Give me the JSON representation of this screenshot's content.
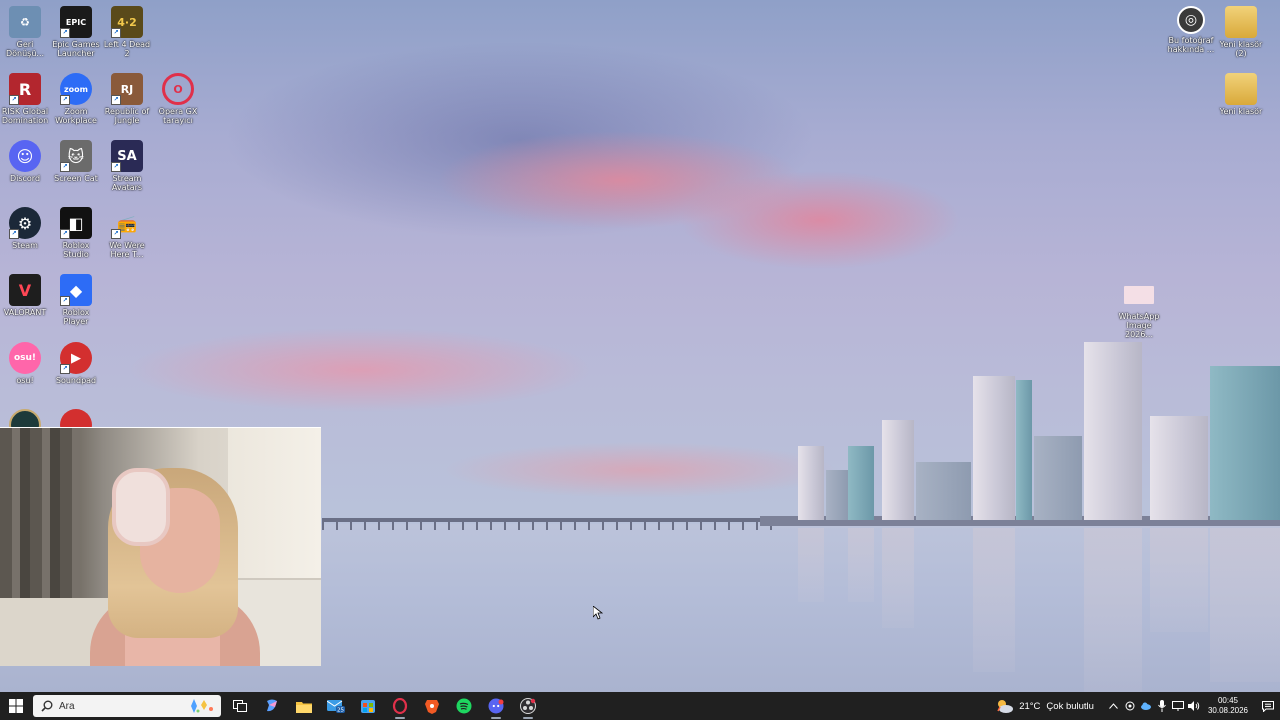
{
  "desktop": {
    "icons": [
      {
        "name": "recycle-bin",
        "label": "Geri Dönüşü...",
        "color": "#6d8fb3",
        "glyph": "♻"
      },
      {
        "name": "epic-games",
        "label": "Epic Games Launcher",
        "color": "#1a1a1a",
        "glyph": "EPIC"
      },
      {
        "name": "left-4-dead-2",
        "label": "Left 4 Dead 2",
        "color": "#5a4a1a",
        "glyph": "4·2"
      },
      {
        "name": "risk-global-domination",
        "label": "RISK Global Domination",
        "color": "#b3262e",
        "glyph": "R"
      },
      {
        "name": "zoom-workplace",
        "label": "Zoom Workplace",
        "color": "#2d6cf6",
        "glyph": "zoom"
      },
      {
        "name": "republic-of-jungle",
        "label": "Republic of Jungle",
        "color": "#8a5a3a",
        "glyph": "RJ"
      },
      {
        "name": "opera-gx",
        "label": "Opera GX tarayıcı",
        "color": "#ffffff",
        "glyph": "O"
      },
      {
        "name": "discord",
        "label": "Discord",
        "color": "#5865f2",
        "glyph": "☺"
      },
      {
        "name": "screen-cat",
        "label": "Screen Cat",
        "color": "#6b6b6b",
        "glyph": "🐱"
      },
      {
        "name": "stream-avatars",
        "label": "Stream Avatars",
        "color": "#2a2a55",
        "glyph": "SA"
      },
      {
        "name": "steam",
        "label": "Steam",
        "color": "#1b2838",
        "glyph": "⚙"
      },
      {
        "name": "roblox-studio",
        "label": "Roblox Studio",
        "color": "#111111",
        "glyph": "◧"
      },
      {
        "name": "we-were-here",
        "label": "We Were Here T...",
        "color": "#b83a2a",
        "glyph": "📻"
      },
      {
        "name": "valorant",
        "label": "VALORANT",
        "color": "#1e1e1e",
        "glyph": "V"
      },
      {
        "name": "roblox-player",
        "label": "Roblox Player",
        "color": "#2d6cf6",
        "glyph": "◆"
      },
      {
        "name": "osu",
        "label": "osu!",
        "color": "#ff66aa",
        "glyph": "osu!"
      },
      {
        "name": "soundpad",
        "label": "Soundpad",
        "color": "#d32f2f",
        "glyph": "▶"
      },
      {
        "name": "photo-info",
        "label": "Bu fotoğraf hakkında ...",
        "color": "#3a3a3a",
        "glyph": "◎"
      },
      {
        "name": "new-folder-2",
        "label": "Yeni klasör (2)",
        "color": "#e9c46a",
        "glyph": "▬"
      },
      {
        "name": "new-folder",
        "label": "Yeni klasör",
        "color": "#e9c46a",
        "glyph": "▬"
      },
      {
        "name": "whatsapp-image",
        "label": "WhatsApp Image 2026...",
        "color": "#f4dfe6",
        "glyph": ""
      }
    ]
  },
  "taskbar": {
    "search_placeholder": "Ara",
    "apps": [
      {
        "name": "task-view",
        "glyph": "▣",
        "color": "#ffffff",
        "running": false
      },
      {
        "name": "copilot",
        "glyph": "✦",
        "color": "#7db4ff",
        "running": false
      },
      {
        "name": "file-explorer",
        "glyph": "▬",
        "color": "#f5c342",
        "running": false
      },
      {
        "name": "mail-badge",
        "glyph": "✉",
        "color": "#3b9ce6",
        "running": false
      },
      {
        "name": "store",
        "glyph": "▦",
        "color": "#4aa3f0",
        "running": false
      },
      {
        "name": "opera-gx-taskbar",
        "glyph": "O",
        "color": "#e0304a",
        "running": true
      },
      {
        "name": "brave",
        "glyph": "◆",
        "color": "#f25a24",
        "running": false
      },
      {
        "name": "spotify",
        "glyph": "≋",
        "color": "#1ed760",
        "running": false
      },
      {
        "name": "discord-taskbar",
        "glyph": "☺",
        "color": "#5865f2",
        "running": true
      },
      {
        "name": "obs",
        "glyph": "◉",
        "color": "#d8d8d8",
        "running": true
      }
    ],
    "weather": {
      "temp": "21°C",
      "condition": "Çok bulutlu"
    },
    "clock": {
      "time": "00:45",
      "date": "30.08.2026"
    }
  }
}
